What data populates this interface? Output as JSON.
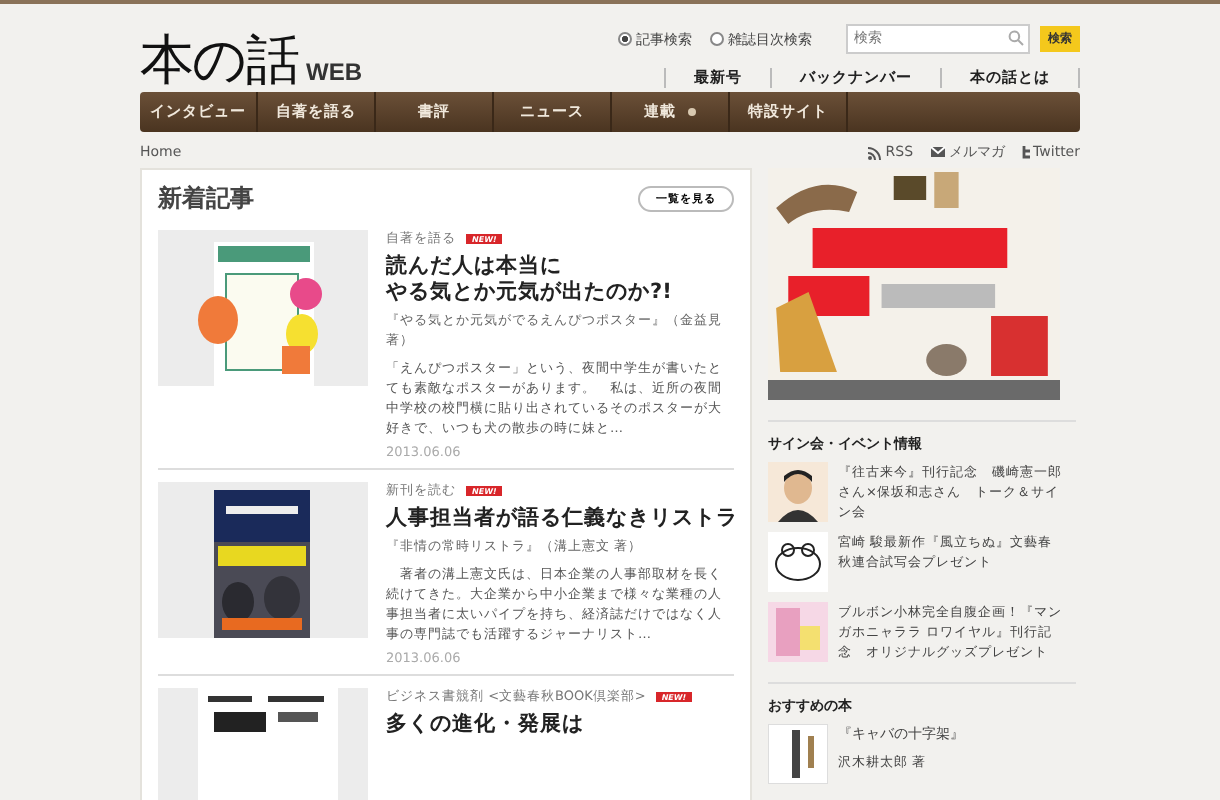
{
  "header": {
    "logo": "本の話",
    "logo_suffix": "WEB",
    "search_modes": [
      {
        "label": "記事検索",
        "selected": true
      },
      {
        "label": "雑誌目次検索",
        "selected": false
      }
    ],
    "search": {
      "placeholder": "検索",
      "button": "検索"
    },
    "links": [
      "最新号",
      "バックナンバー",
      "本の話とは"
    ]
  },
  "nav": [
    {
      "label": "インタビュー",
      "dropdown": false
    },
    {
      "label": "自著を語る",
      "dropdown": false
    },
    {
      "label": "書評",
      "dropdown": false
    },
    {
      "label": "ニュース",
      "dropdown": false
    },
    {
      "label": "連載",
      "dropdown": true
    },
    {
      "label": "特設サイト",
      "dropdown": false
    }
  ],
  "breadcrumb": "Home",
  "feeds": [
    "RSS",
    "メルマガ",
    "Twitter"
  ],
  "news": {
    "title": "新着記事",
    "more": "一覧を見る",
    "articles": [
      {
        "category": "自著を語る",
        "badge": "NEW!",
        "title_lines": [
          "読んだ人は本当に",
          "やる気とか元気が出たのか?!"
        ],
        "book": "『やる気とか元気がでるえんぴつポスター』（金益見著）",
        "summary": "「えんぴつポスター」という、夜間中学生が書いたとても素敵なポスターがあります。　私は、近所の夜間中学校の校門横に貼り出されているそのポスターが大好きで、いつも犬の散歩の時に妹と…",
        "date": "2013.06.06"
      },
      {
        "category": "新刊を読む",
        "badge": "NEW!",
        "title_lines": [
          "人事担当者が語る仁義なきリストラ"
        ],
        "book": "『非情の常時リストラ』（溝上憲文 著）",
        "summary": "　著者の溝上憲文氏は、日本企業の人事部取材を長く続けてきた。大企業から中小企業まで様々な業種の人事担当者に太いパイプを持ち、経済誌だけではなく人事の専門誌でも活躍するジャーナリスト…",
        "date": "2013.06.06"
      },
      {
        "category": "ビジネス書競剤 <文藝春秋BOOK倶楽部>",
        "badge": "NEW!",
        "title_lines": [
          "多くの進化・発展は"
        ]
      }
    ]
  },
  "sidebar": {
    "events_title": "サイン会・イベント情報",
    "events": [
      {
        "text": "『往古来今』刊行記念　磯崎憲一郎さん×保坂和志さん　トーク＆サイン会"
      },
      {
        "text": "宮崎 駿最新作『風立ちぬ』文藝春秋連合試写会プレゼント"
      },
      {
        "text": "ブルボン小林完全自腹企画！『マンガホニャララ ロワイヤル』刊行記念　オリジナルグッズプレゼント"
      }
    ],
    "books_title": "おすすめの本",
    "books": [
      {
        "title": "『キャバの十字架』",
        "author": "沢木耕太郎 著"
      }
    ]
  }
}
